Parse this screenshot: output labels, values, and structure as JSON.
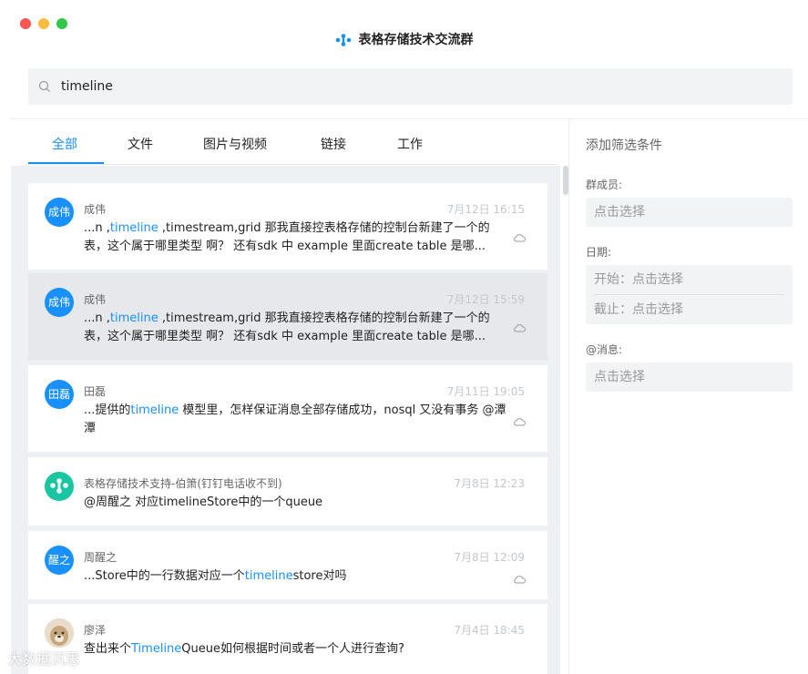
{
  "window": {
    "title": "表格存储技术交流群"
  },
  "search": {
    "value": "timeline"
  },
  "tabs": [
    {
      "label": "全部",
      "active": true
    },
    {
      "label": "文件",
      "active": false
    },
    {
      "label": "图片与视频",
      "active": false
    },
    {
      "label": "链接",
      "active": false
    },
    {
      "label": "工作",
      "active": false
    }
  ],
  "results": [
    {
      "avatar": "成伟",
      "sender": "成伟",
      "time": "7月12日 16:15",
      "pre": "...n ,",
      "hl": "timeline",
      "post": " ,timestream,grid 那我直接控表格存储的控制台新建了一个的表，这个属于哪里类型 啊？ 还有sdk 中 example 里面create table 是哪..."
    },
    {
      "avatar": "成伟",
      "sender": "成伟",
      "time": "7月12日 15:59",
      "pre": "...n ,",
      "hl": "timeline",
      "post": " ,timestream,grid 那我直接控表格存储的控制台新建了一个的表，这个属于哪里类型 啊？ 还有sdk 中 example 里面create table 是哪..."
    },
    {
      "avatar": "田磊",
      "sender": "田磊",
      "time": "7月11日 19:05",
      "pre": "...提供的",
      "hl": "timeline",
      "post": " 模型里，怎样保证消息全部存储成功，nosql 又没有事务 @潭潭"
    },
    {
      "avatar": "",
      "sender": "表格存储技术支持-伯箫(钉钉电话收不到)",
      "time": "7月8日 12:23",
      "pre": "@周醒之 对应timelineStore中的一个queue",
      "hl": "",
      "post": ""
    },
    {
      "avatar": "醒之",
      "sender": "周醒之",
      "time": "7月8日 12:09",
      "pre": "...Store中的一行数据对应一个",
      "hl": "timeline",
      "post": "store对吗"
    },
    {
      "avatar": "",
      "sender": "廖泽",
      "time": "7月4日 18:45",
      "pre": "查出来个",
      "hl": "Timeline",
      "post": "Queue如何根据时间或者一个人进行查询?"
    }
  ],
  "filter": {
    "title": "添加筛选条件",
    "member_label": "群成员:",
    "member_value": "点击选择",
    "date_label": "日期:",
    "date_start": "开始：点击选择",
    "date_end": "截止：点击选择",
    "mention_label": "@消息:",
    "mention_value": "点击选择"
  },
  "watermark": "大数据沉思",
  "colors": {
    "accent": "#1890ff",
    "teal": "#1ac5a2"
  }
}
